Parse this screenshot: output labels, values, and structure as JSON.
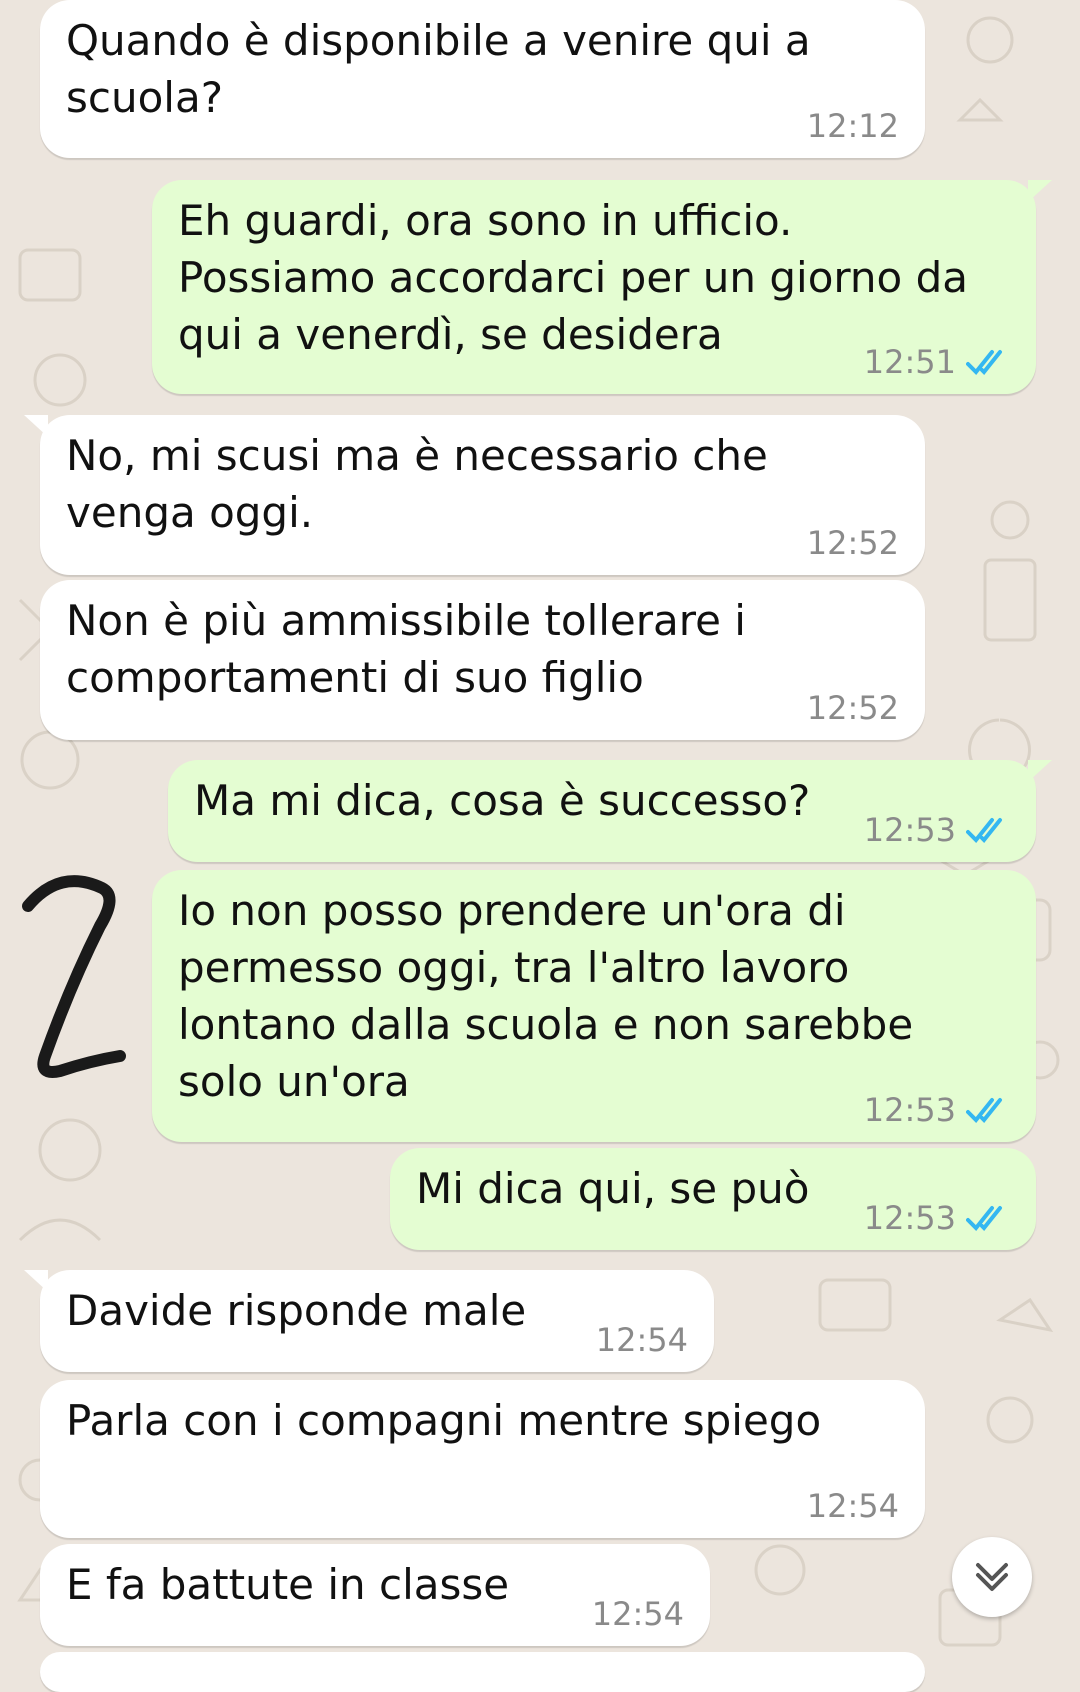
{
  "messages": [
    {
      "id": "m1",
      "dir": "in",
      "text": "Quando è disponibile a venire qui a\nscuola?",
      "time": "12:12"
    },
    {
      "id": "m2",
      "dir": "out",
      "text": "Eh guardi, ora sono in ufficio.\nPossiamo accordarci per un giorno da\nqui a venerdì, se desidera",
      "time": "12:51",
      "status": "read"
    },
    {
      "id": "m3",
      "dir": "in",
      "text": "No, mi scusi ma è necessario che\nvenga oggi.",
      "time": "12:52"
    },
    {
      "id": "m4",
      "dir": "in",
      "text": "Non è più ammissibile tollerare i\ncomportamenti di suo figlio",
      "time": "12:52"
    },
    {
      "id": "m5",
      "dir": "out",
      "text": "Ma mi dica, cosa è successo?",
      "time": "12:53",
      "status": "read"
    },
    {
      "id": "m6",
      "dir": "out",
      "text": "Io non posso prendere un'ora di\npermesso oggi, tra l'altro lavoro\nlontano dalla scuola e non sarebbe\nsolo un'ora",
      "time": "12:53",
      "status": "read"
    },
    {
      "id": "m7",
      "dir": "out",
      "text": "Mi dica qui, se può",
      "time": "12:53",
      "status": "read"
    },
    {
      "id": "m8",
      "dir": "in",
      "text": "Davide risponde male",
      "time": "12:54"
    },
    {
      "id": "m9",
      "dir": "in",
      "text": "Parla con i compagni mentre spiego",
      "time": "12:54"
    },
    {
      "id": "m10",
      "dir": "in",
      "text": "E fa battute in classe",
      "time": "12:54"
    }
  ],
  "colors": {
    "wallpaper": "#ece5dd",
    "incoming_bubble": "#ffffff",
    "outgoing_bubble": "#e4fdd2",
    "read_ticks": "#34b7f1",
    "timestamp": "#8a8a8a",
    "annotation": "#1a1a1a"
  },
  "icons": {
    "read_receipt": "double-check-icon",
    "scroll_down": "chevron-double-down-icon",
    "annotation": "handwritten-number-icon"
  }
}
